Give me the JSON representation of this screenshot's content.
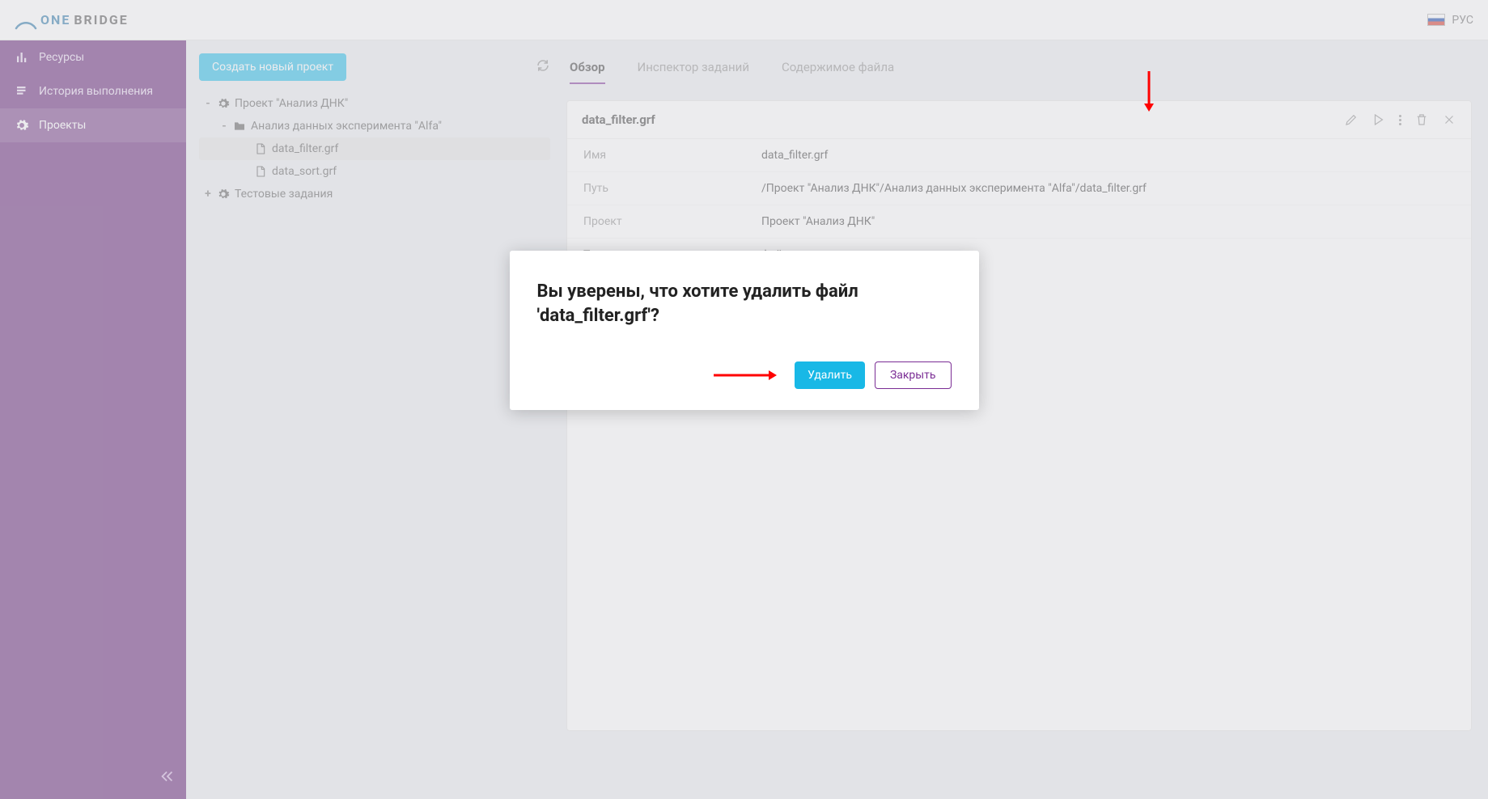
{
  "brand": {
    "one": "ONE",
    "bridge": "BRIDGE"
  },
  "lang": {
    "label": "РУС"
  },
  "sidebar": {
    "resources": "Ресурсы",
    "history": "История выполнения",
    "projects": "Проекты"
  },
  "tree": {
    "create_button": "Создать новый проект",
    "root1": "Проект \"Анализ ДНК\"",
    "folder1": "Анализ данных эксперимента \"Alfa\"",
    "file1": "data_filter.grf",
    "file2": "data_sort.grf",
    "root2": "Тестовые задания"
  },
  "tabs": {
    "overview": "Обзор",
    "inspector": "Инспектор заданий",
    "contents": "Содержимое файла"
  },
  "card": {
    "title": "data_filter.grf",
    "rows": {
      "name_k": "Имя",
      "name_v": "data_filter.grf",
      "path_k": "Путь",
      "path_v": "/Проект \"Анализ ДНК\"/Анализ данных эксперимента \"Alfa\"/data_filter.grf",
      "project_k": "Проект",
      "project_v": "Проект \"Анализ ДНК\"",
      "type_k": "Тип",
      "type_v": "файл"
    }
  },
  "modal": {
    "title": "Вы уверены, что хотите удалить файл 'data_filter.grf'?",
    "delete": "Удалить",
    "close": "Закрыть"
  }
}
